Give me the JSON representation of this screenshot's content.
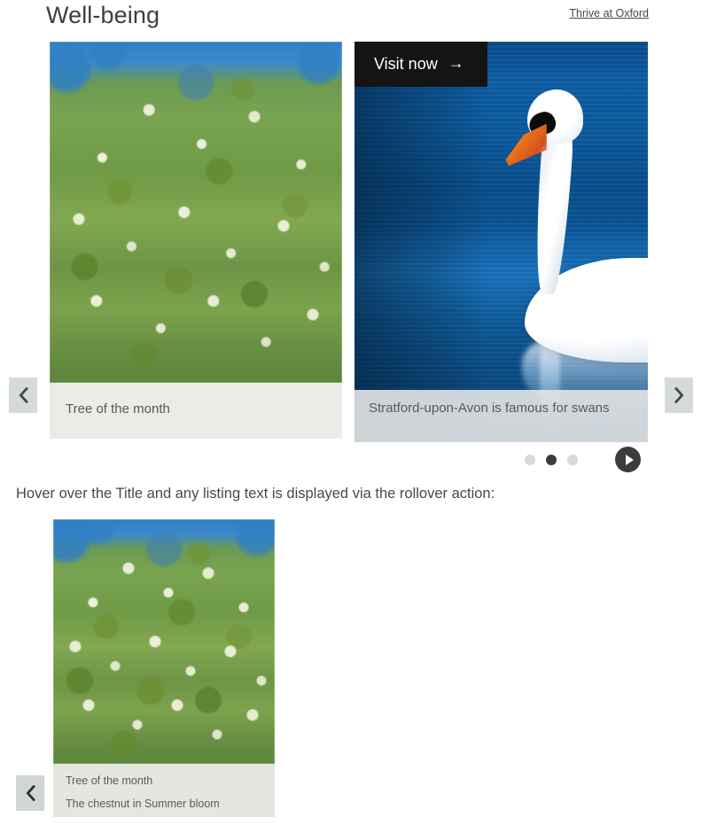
{
  "header": {
    "title": "Well-being",
    "link_label": "Thrive at Oxford"
  },
  "carousel": {
    "prev_label": "‹",
    "next_label": "›",
    "visit_badge": {
      "label": "Visit now",
      "arrow": "→"
    },
    "slides": [
      {
        "caption_title": "Tree of the month",
        "image_alt": "chestnut-tree-in-bloom"
      },
      {
        "caption_title": "Stratford-upon-Avon is famous for swans",
        "image_alt": "white-swan-on-blue-water"
      }
    ],
    "dots": [
      {
        "active": false
      },
      {
        "active": true
      },
      {
        "active": false
      }
    ],
    "play_label": "Play"
  },
  "note": {
    "text": "Hover over the Title and any listing text is displayed via the rollover action:"
  },
  "hover_card": {
    "caption_title": "Tree of the month",
    "caption_subtitle": "The chestnut in Summer bloom",
    "prev_label": "‹",
    "image_alt": "chestnut-tree-in-bloom"
  },
  "colors": {
    "title_text": "#3f3f41",
    "body_text": "#45494d",
    "caption_text": "#58585a",
    "badge_background": "#141414",
    "badge_text": "#ffffff",
    "arrow_button_background": "#d5dbd8",
    "dot_active": "#3c3c3c",
    "dot_inactive": "#d9d9d9",
    "page_background": "#ffffff"
  }
}
